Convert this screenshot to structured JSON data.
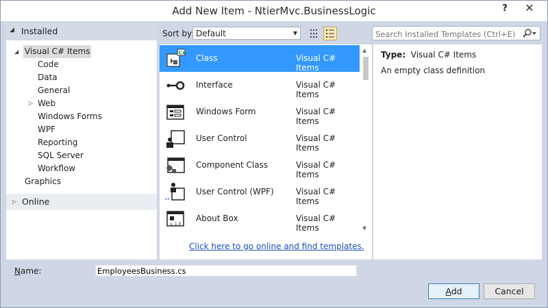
{
  "window": {
    "title": "Add New Item - NtierMvc.BusinessLogic",
    "help_label": "?",
    "close_label": "✕"
  },
  "tree": {
    "installed_label": "Installed",
    "root_label": "Visual C# Items",
    "children": [
      "Code",
      "Data",
      "General",
      "Web",
      "Windows Forms",
      "WPF",
      "Reporting",
      "SQL Server",
      "Workflow"
    ],
    "graphics_label": "Graphics",
    "online_label": "Online"
  },
  "toolbar": {
    "sort_label": "Sort by:",
    "sort_value": "Default",
    "search_placeholder": "Search Installed Templates (Ctrl+E)"
  },
  "templates": [
    {
      "name": "Class",
      "category": "Visual C# Items",
      "icon": "class-icon",
      "selected": true
    },
    {
      "name": "Interface",
      "category": "Visual C# Items",
      "icon": "interface-icon",
      "selected": false
    },
    {
      "name": "Windows Form",
      "category": "Visual C# Items",
      "icon": "windows-form-icon",
      "selected": false
    },
    {
      "name": "User Control",
      "category": "Visual C# Items",
      "icon": "user-control-icon",
      "selected": false
    },
    {
      "name": "Component Class",
      "category": "Visual C# Items",
      "icon": "component-class-icon",
      "selected": false
    },
    {
      "name": "User Control (WPF)",
      "category": "Visual C# Items",
      "icon": "user-control-wpf-icon",
      "selected": false
    },
    {
      "name": "About Box",
      "category": "Visual C# Items",
      "icon": "about-box-icon",
      "selected": false
    }
  ],
  "online_link": "Click here to go online and find templates.",
  "details": {
    "type_label": "Type:",
    "type_value": "Visual C# Items",
    "description": "An empty class definition"
  },
  "footer": {
    "name_label_prefix": "",
    "name_label_accel": "N",
    "name_label_rest": "ame:",
    "name_value": "EmployeesBusiness.cs",
    "add_accel": "A",
    "add_rest": "dd",
    "cancel_label": "Cancel"
  },
  "colors": {
    "selection": "#3399ff",
    "dialog_bg": "#cfd6e5",
    "link": "#1a4fb8"
  }
}
